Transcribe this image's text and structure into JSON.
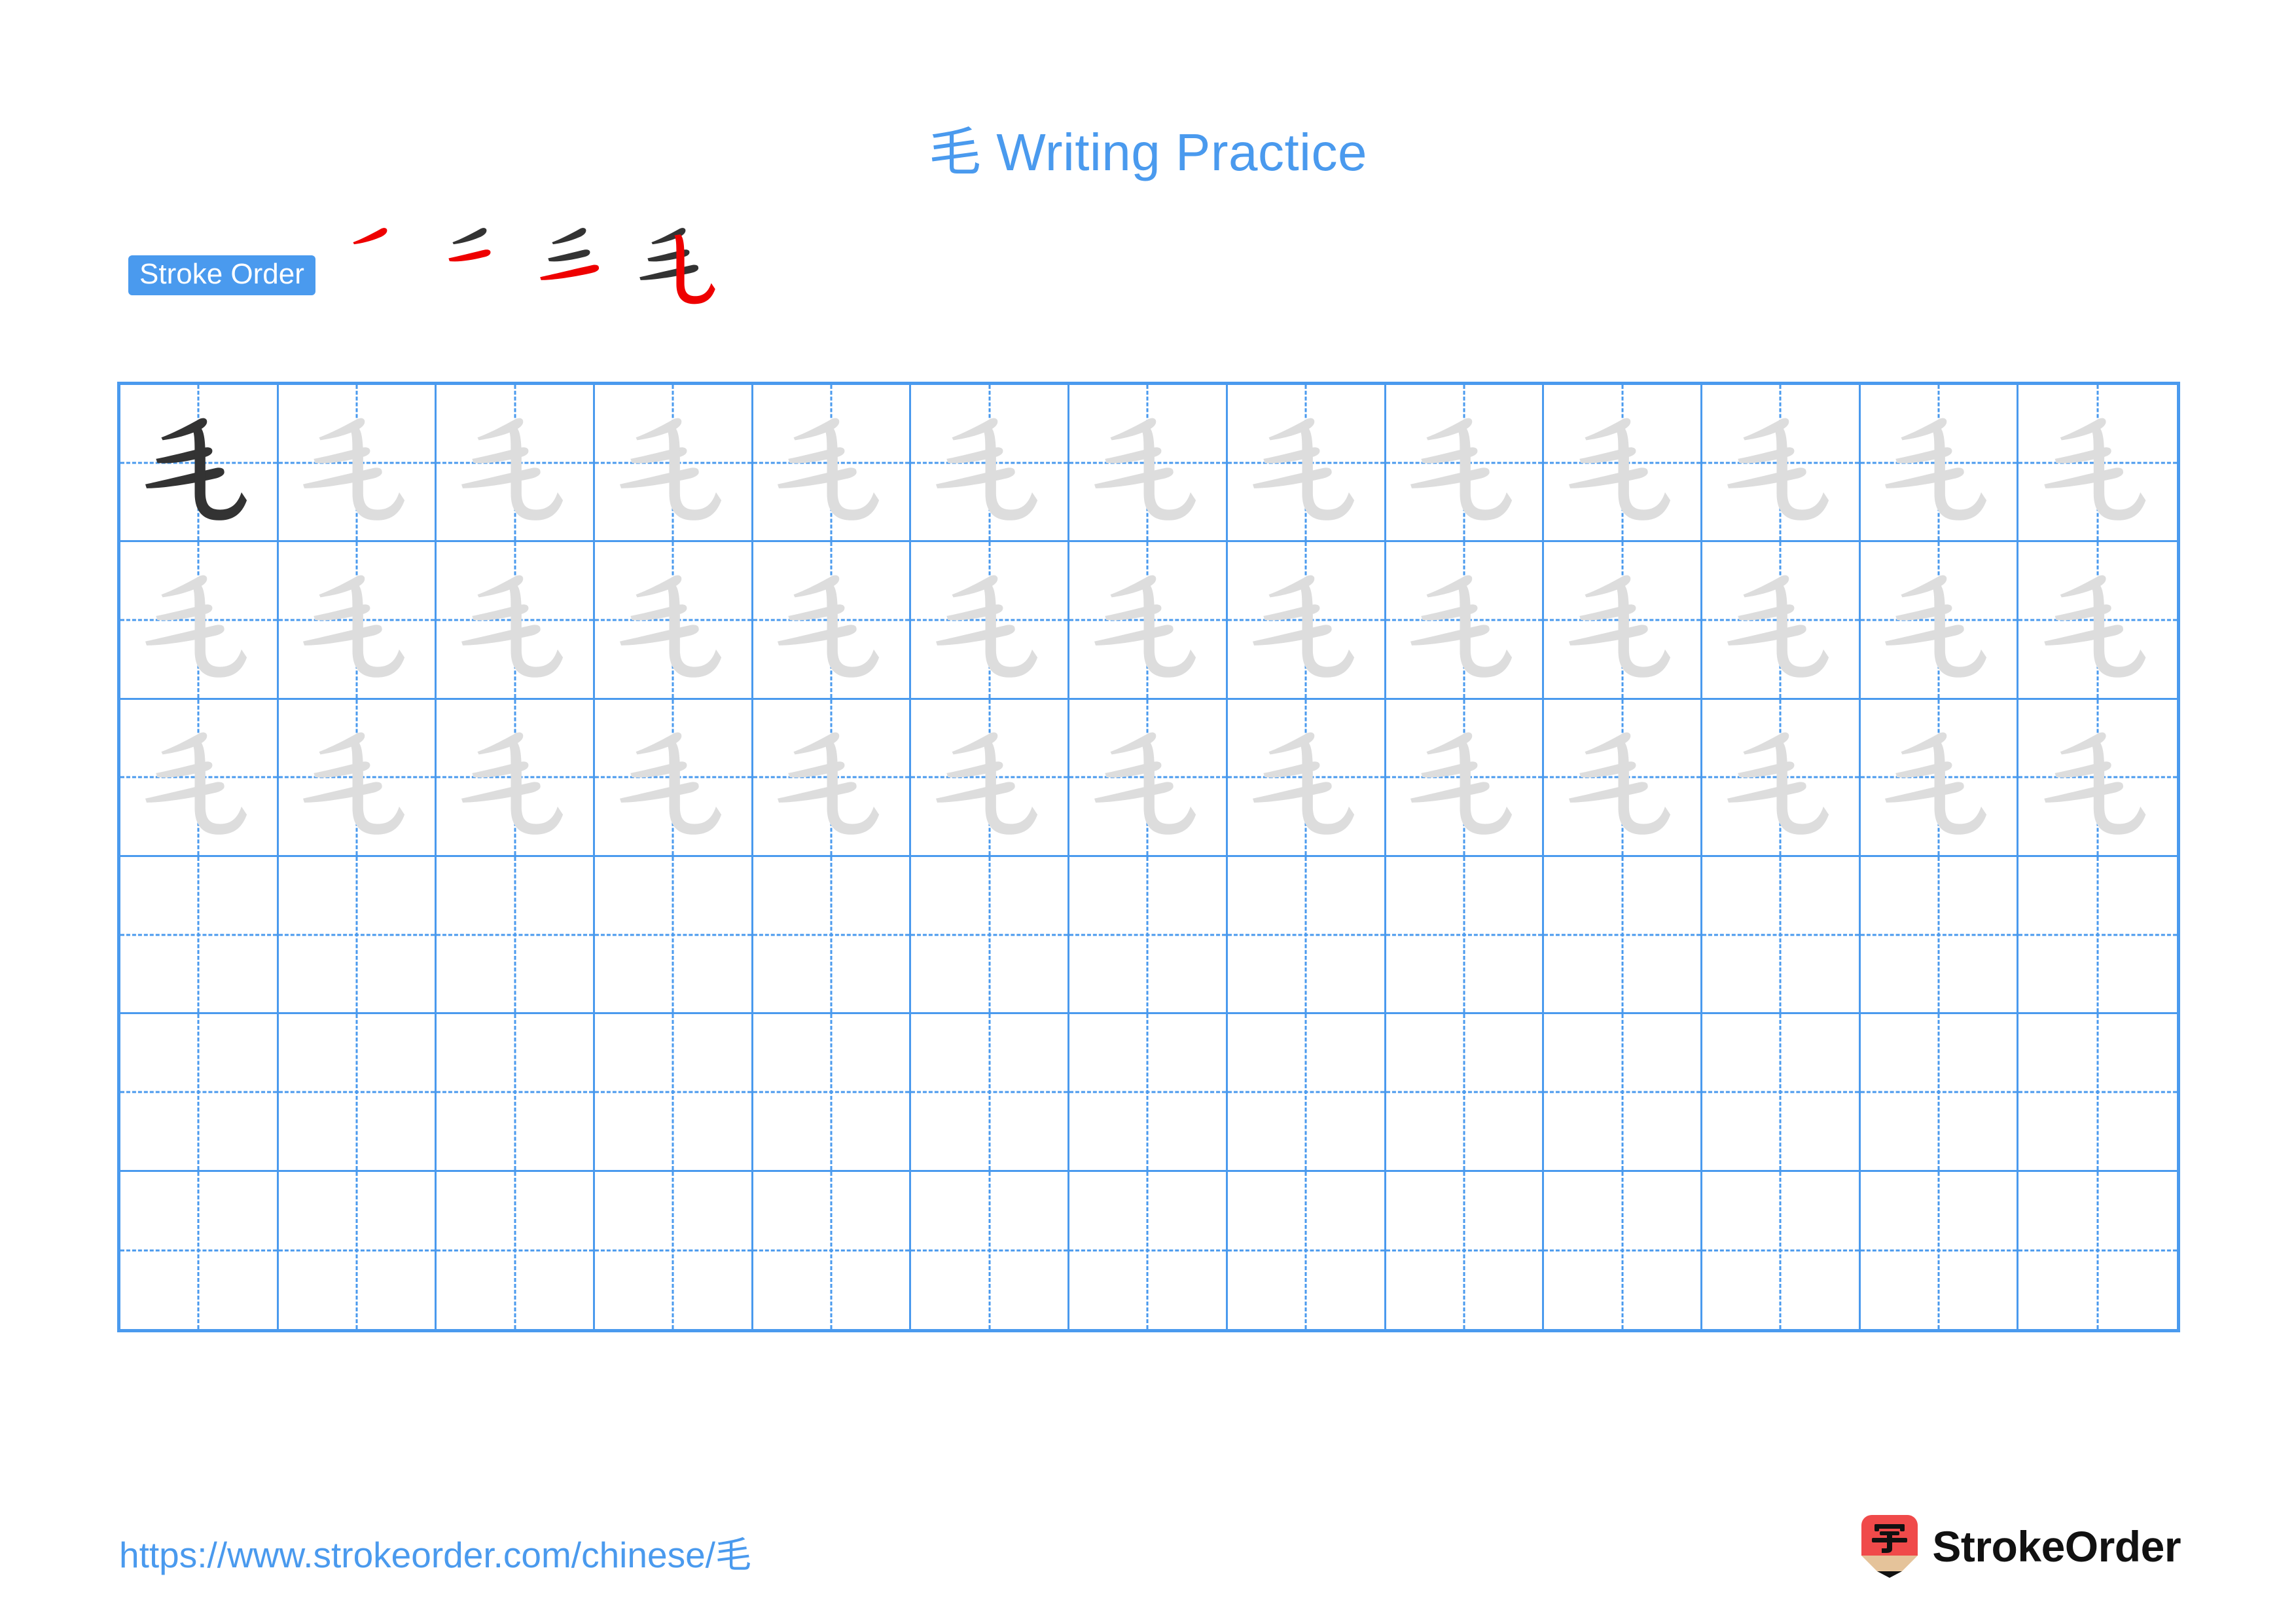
{
  "page": {
    "character": "毛",
    "title": "毛 Writing Practice",
    "accent_color": "#4A9AEE",
    "stroke_highlight_color": "#EE0000",
    "stroke_done_color": "#333333",
    "trace_color": "#DDDDDD"
  },
  "stroke_order": {
    "badge_label": "Stroke Order",
    "total_strokes": 4,
    "steps": [
      {
        "step": 1,
        "new_stroke": 1,
        "strokes_shown": [
          1
        ],
        "name": "stroke-step-1"
      },
      {
        "step": 2,
        "new_stroke": 2,
        "strokes_shown": [
          1,
          2
        ],
        "name": "stroke-step-2"
      },
      {
        "step": 3,
        "new_stroke": 3,
        "strokes_shown": [
          1,
          2,
          3
        ],
        "name": "stroke-step-3"
      },
      {
        "step": 4,
        "new_stroke": 4,
        "strokes_shown": [
          1,
          2,
          3,
          4
        ],
        "name": "stroke-step-4"
      }
    ]
  },
  "practice_grid": {
    "columns": 13,
    "rows": 6,
    "filled_rows": 3,
    "cells": [
      [
        "毛",
        "毛",
        "毛",
        "毛",
        "毛",
        "毛",
        "毛",
        "毛",
        "毛",
        "毛",
        "毛",
        "毛",
        "毛"
      ],
      [
        "毛",
        "毛",
        "毛",
        "毛",
        "毛",
        "毛",
        "毛",
        "毛",
        "毛",
        "毛",
        "毛",
        "毛",
        "毛"
      ],
      [
        "毛",
        "毛",
        "毛",
        "毛",
        "毛",
        "毛",
        "毛",
        "毛",
        "毛",
        "毛",
        "毛",
        "毛",
        "毛"
      ],
      [
        "",
        "",
        "",
        "",
        "",
        "",
        "",
        "",
        "",
        "",
        "",
        "",
        ""
      ],
      [
        "",
        "",
        "",
        "",
        "",
        "",
        "",
        "",
        "",
        "",
        "",
        "",
        ""
      ],
      [
        "",
        "",
        "",
        "",
        "",
        "",
        "",
        "",
        "",
        "",
        "",
        "",
        ""
      ]
    ],
    "first_cell_is_dark": true
  },
  "footer": {
    "url": "https://www.strokeorder.com/chinese/毛",
    "brand_name": "StrokeOrder",
    "logo_character": "字",
    "logo_body_color": "#F04A4A",
    "logo_wood_color": "#E5C39A",
    "logo_tip_color": "#111111"
  }
}
